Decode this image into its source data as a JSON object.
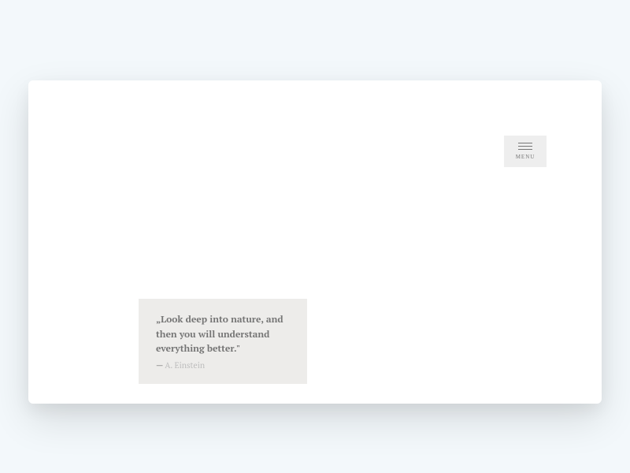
{
  "menu": {
    "label": "MENU"
  },
  "quote": {
    "text": "„Look deep into nature, and then you will understand everything better.\"",
    "dash": "— ",
    "author": "A. Einstein"
  }
}
